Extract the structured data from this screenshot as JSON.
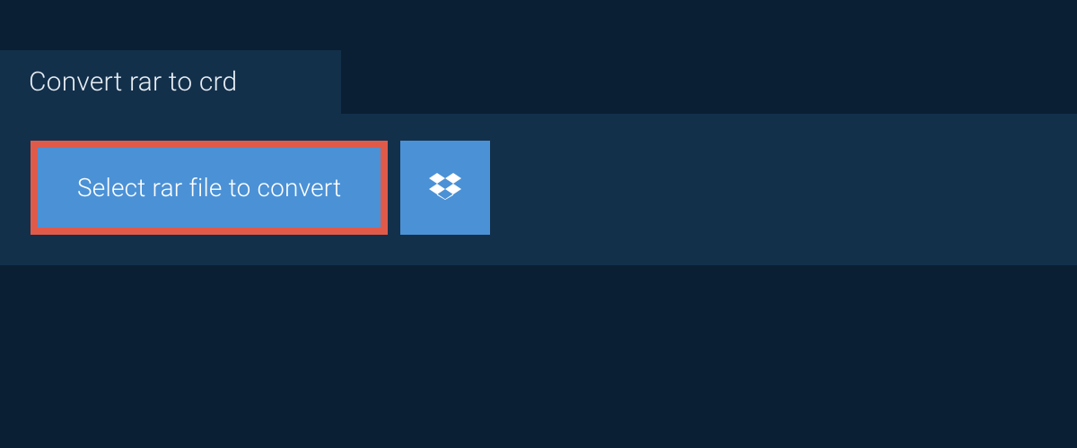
{
  "tab": {
    "title": "Convert rar to crd"
  },
  "actions": {
    "select_label": "Select rar file to convert"
  }
}
